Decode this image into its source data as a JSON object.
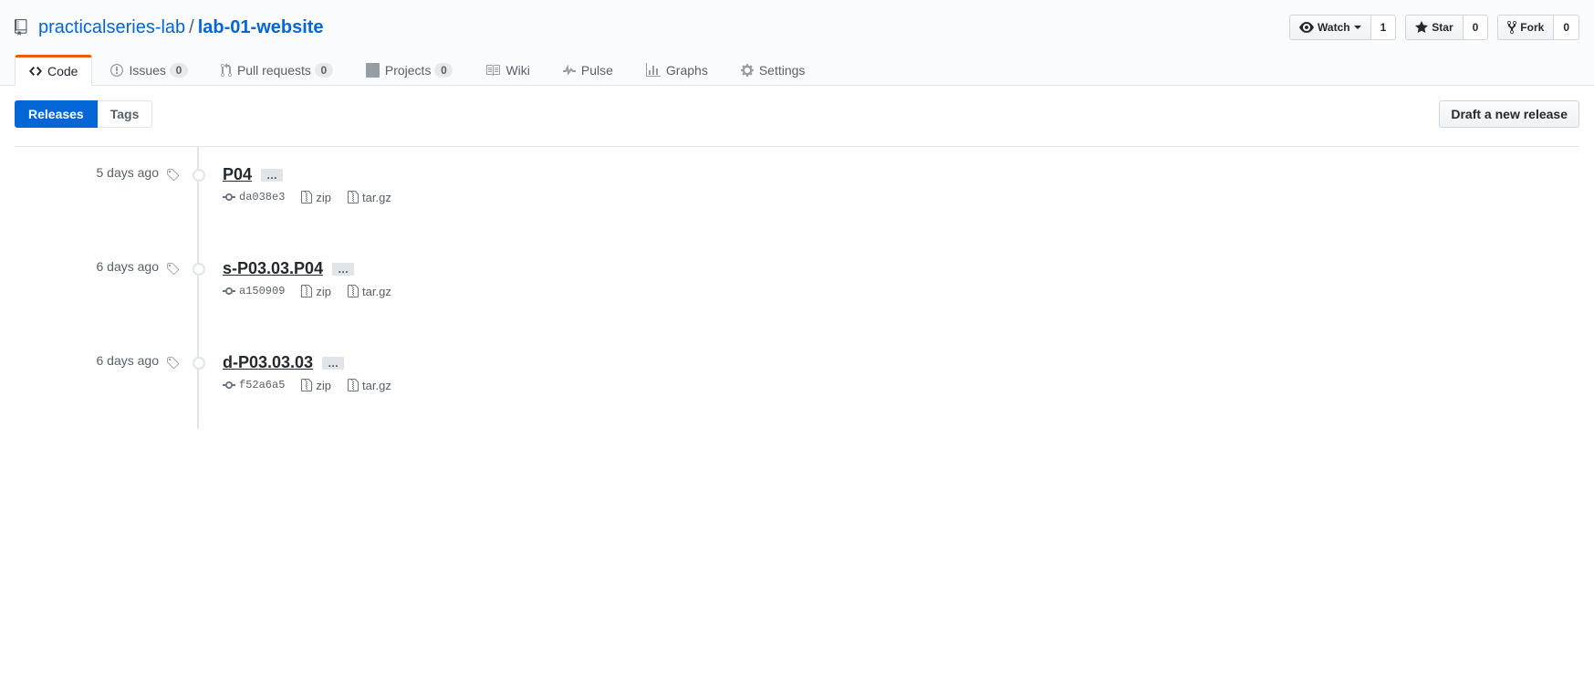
{
  "repo": {
    "owner": "practicalseries-lab",
    "name": "lab-01-website"
  },
  "actions": {
    "watch": {
      "label": "Watch",
      "count": "1"
    },
    "star": {
      "label": "Star",
      "count": "0"
    },
    "fork": {
      "label": "Fork",
      "count": "0"
    }
  },
  "nav": {
    "code": {
      "label": "Code"
    },
    "issues": {
      "label": "Issues",
      "count": "0"
    },
    "pull_requests": {
      "label": "Pull requests",
      "count": "0"
    },
    "projects": {
      "label": "Projects",
      "count": "0"
    },
    "wiki": {
      "label": "Wiki"
    },
    "pulse": {
      "label": "Pulse"
    },
    "graphs": {
      "label": "Graphs"
    },
    "settings": {
      "label": "Settings"
    }
  },
  "subnav": {
    "releases": "Releases",
    "tags": "Tags",
    "draft_button": "Draft a new release"
  },
  "labels": {
    "zip": "zip",
    "targz": "tar.gz",
    "ellipsis": "…"
  },
  "releases": [
    {
      "date": "5 days ago",
      "title": "P04",
      "commit": "da038e3"
    },
    {
      "date": "6 days ago",
      "title": "s-P03.03.P04",
      "commit": "a150909"
    },
    {
      "date": "6 days ago",
      "title": "d-P03.03.03",
      "commit": "f52a6a5"
    }
  ]
}
